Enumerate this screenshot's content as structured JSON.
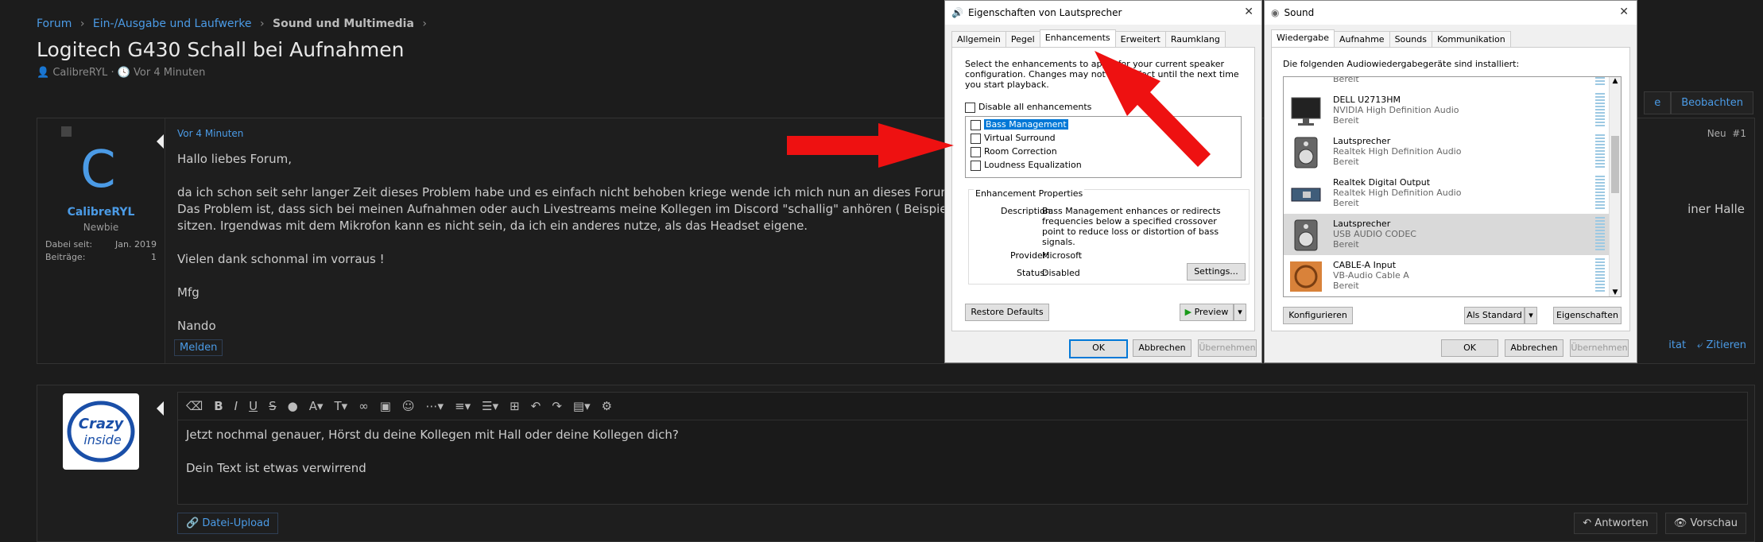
{
  "breadcrumb": {
    "root": "Forum",
    "cat": "Ein-/Ausgabe und Laufwerke",
    "sub": "Sound und Multimedia",
    "sep": "›"
  },
  "thread": {
    "title": "Logitech G430 Schall bei Aufnahmen",
    "author": "CalibreRYL",
    "time": "Vor 4 Minuten"
  },
  "top_buttons": {
    "left_partial": "e",
    "watch": "Beobachten"
  },
  "post": {
    "avatar_letter": "C",
    "username": "CalibreRYL",
    "usertitle": "Newbie",
    "stats": [
      {
        "label": "Dabei seit:",
        "value": "Jan. 2019"
      },
      {
        "label": "Beiträge:",
        "value": "1"
      }
    ],
    "time": "Vor 4 Minuten",
    "badge": "Neu",
    "number": "#1",
    "lines": [
      "Hallo liebes Forum,",
      "da ich schon seit sehr langer Zeit dieses Problem habe und es einfach nicht behoben kriege wende ich mich nun an dieses Forum, in der Hoffnung",
      "Das Problem ist, dass sich bei meinen Aufnahmen oder auch Livestreams meine Kollegen im Discord \"schallig\" anhören ( Beispiel : https://www.twi",
      "sitzen. Irgendwas mit dem Mikrofon kann es nicht sein, da ich ein anderes nutze, als das Headset eigene.",
      "Vielen dank schonmal im vorraus !",
      "Mfg",
      "Nando"
    ],
    "line_overflow": "iner Halle",
    "report": "Melden",
    "actions": {
      "partial": "itat",
      "quote": "Zitieren"
    }
  },
  "reply": {
    "avatar_text": "Crazy inside",
    "lines": [
      "Jetzt nochmal genauer, Hörst du deine Kollegen mit Hall oder deine Kollegen dich?",
      "Dein Text ist etwas verwirrend"
    ],
    "upload": "Datei-Upload",
    "reply_btn": "Antworten",
    "preview_btn": "Vorschau"
  },
  "dialog1": {
    "title": "Eigenschaften von Lautsprecher",
    "tabs": [
      "Allgemein",
      "Pegel",
      "Enhancements",
      "Erweitert",
      "Raumklang"
    ],
    "intro": "Select the enhancements to apply for your current speaker configuration. Changes may not take effect until the next time you start playback.",
    "disable_all": "Disable all enhancements",
    "enhancements": [
      "Bass Management",
      "Virtual Surround",
      "Room Correction",
      "Loudness Equalization"
    ],
    "props_title": "Enhancement Properties",
    "desc_label": "Description:",
    "desc": "Bass Management enhances or redirects frequencies below a specified crossover point to reduce loss or distortion of bass signals.",
    "provider_label": "Provider:",
    "provider": "Microsoft",
    "status_label": "Status:",
    "status": "Disabled",
    "settings_btn": "Settings...",
    "restore_btn": "Restore Defaults",
    "preview_btn": "Preview",
    "ok": "OK",
    "cancel": "Abbrechen",
    "apply": "Übernehmen"
  },
  "dialog2": {
    "title": "Sound",
    "tabs": [
      "Wiedergabe",
      "Aufnahme",
      "Sounds",
      "Kommunikation"
    ],
    "intro": "Die folgenden Audiowiedergabegeräte sind installiert:",
    "devices": [
      {
        "name": "",
        "sub": "",
        "status": "Bereit"
      },
      {
        "name": "DELL U2713HM",
        "sub": "NVIDIA High Definition Audio",
        "status": "Bereit"
      },
      {
        "name": "Lautsprecher",
        "sub": "Realtek High Definition Audio",
        "status": "Bereit"
      },
      {
        "name": "Realtek Digital Output",
        "sub": "Realtek High Definition Audio",
        "status": "Bereit"
      },
      {
        "name": "Lautsprecher",
        "sub": "USB AUDIO  CODEC",
        "status": "Bereit"
      },
      {
        "name": "CABLE-A Input",
        "sub": "VB-Audio Cable A",
        "status": "Bereit"
      }
    ],
    "configure": "Konfigurieren",
    "default": "Als Standard",
    "properties": "Eigenschaften",
    "ok": "OK",
    "cancel": "Abbrechen",
    "apply": "Übernehmen"
  }
}
